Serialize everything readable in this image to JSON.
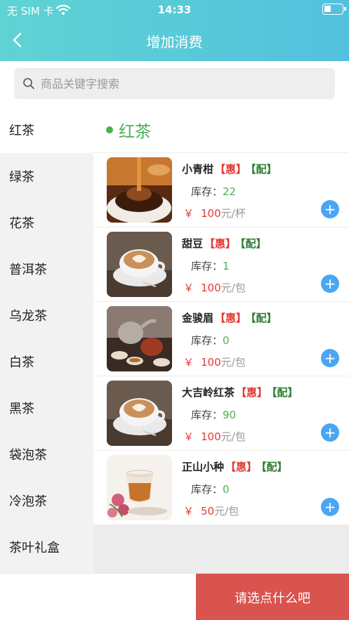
{
  "status_bar": {
    "carrier": "无 SIM 卡",
    "time": "14:33"
  },
  "nav": {
    "title": "增加消费"
  },
  "search": {
    "placeholder": "商品关键字搜索",
    "value": ""
  },
  "sidebar": {
    "items": [
      {
        "label": "红茶",
        "active": true
      },
      {
        "label": "绿茶"
      },
      {
        "label": "花茶"
      },
      {
        "label": "普洱茶"
      },
      {
        "label": "乌龙茶"
      },
      {
        "label": "白茶"
      },
      {
        "label": "黑茶"
      },
      {
        "label": "袋泡茶"
      },
      {
        "label": "冷泡茶"
      },
      {
        "label": "茶叶礼盒"
      }
    ]
  },
  "category": {
    "title": "红茶"
  },
  "products": [
    {
      "name": "小青柑",
      "tag_hui": "【惠】",
      "tag_pei": "【配】",
      "stock_label": "库存：",
      "stock": "22",
      "currency": "￥",
      "price": "100",
      "unit": "元/杯",
      "image": "tea-pouring-image"
    },
    {
      "name": "甜豆",
      "tag_hui": "【惠】",
      "tag_pei": "【配】",
      "stock_label": "库存：",
      "stock": "1",
      "currency": "￥",
      "price": "100",
      "unit": "元/包",
      "image": "latte-cup-image"
    },
    {
      "name": "金骏眉",
      "tag_hui": "【惠】",
      "tag_pei": "【配】",
      "stock_label": "库存：",
      "stock": "0",
      "currency": "￥",
      "price": "100",
      "unit": "元/包",
      "image": "teapot-set-image"
    },
    {
      "name": "大吉岭红茶",
      "tag_hui": "【惠】",
      "tag_pei": "【配】",
      "stock_label": "库存：",
      "stock": "90",
      "currency": "￥",
      "price": "100",
      "unit": "元/包",
      "image": "latte-cup-image"
    },
    {
      "name": "正山小种",
      "tag_hui": "【惠】",
      "tag_pei": "【配】",
      "stock_label": "库存：",
      "stock": "0",
      "currency": "￥",
      "price": "50",
      "unit": "元/包",
      "image": "rose-tea-image"
    }
  ],
  "footer": {
    "checkout_label": "请选点什么吧"
  },
  "colors": {
    "header_start": "#5fd3d3",
    "header_end": "#52c1de",
    "accent_green": "#4caf50",
    "price_red": "#e53935",
    "add_blue": "#4aa6f2",
    "checkout_red": "#d9534f"
  }
}
